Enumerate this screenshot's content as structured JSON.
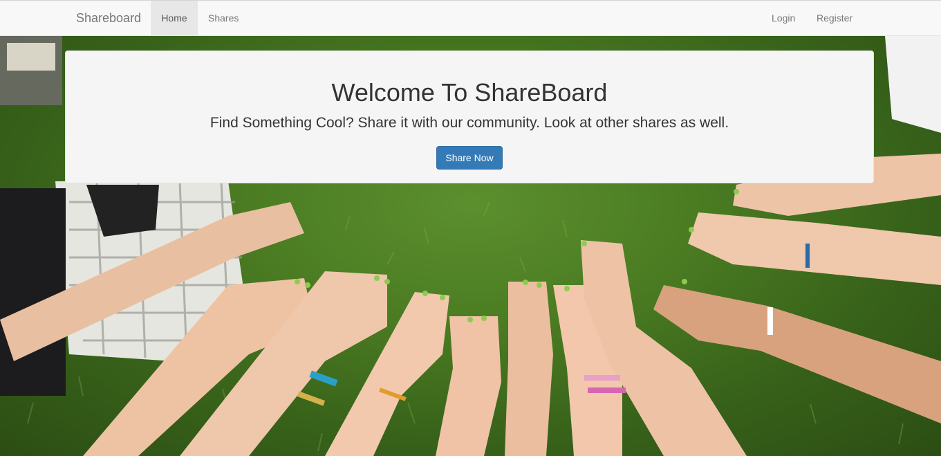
{
  "navbar": {
    "brand": "Shareboard",
    "left_items": [
      {
        "label": "Home",
        "active": true
      },
      {
        "label": "Shares",
        "active": false
      }
    ],
    "right_items": [
      {
        "label": "Login"
      },
      {
        "label": "Register"
      }
    ]
  },
  "jumbotron": {
    "title": "Welcome To ShareBoard",
    "lead": "Find Something Cool? Share it with our community. Look at other shares as well.",
    "button_label": "Share Now"
  },
  "colors": {
    "navbar_bg": "#f8f8f8",
    "active_nav_bg": "#e7e7e7",
    "jumbotron_bg": "#f5f5f5",
    "primary_button": "#337ab7",
    "grass": "#4a7b22"
  },
  "background_image": {
    "semantic": "hands-and-feet-circle-on-grass-photo"
  }
}
